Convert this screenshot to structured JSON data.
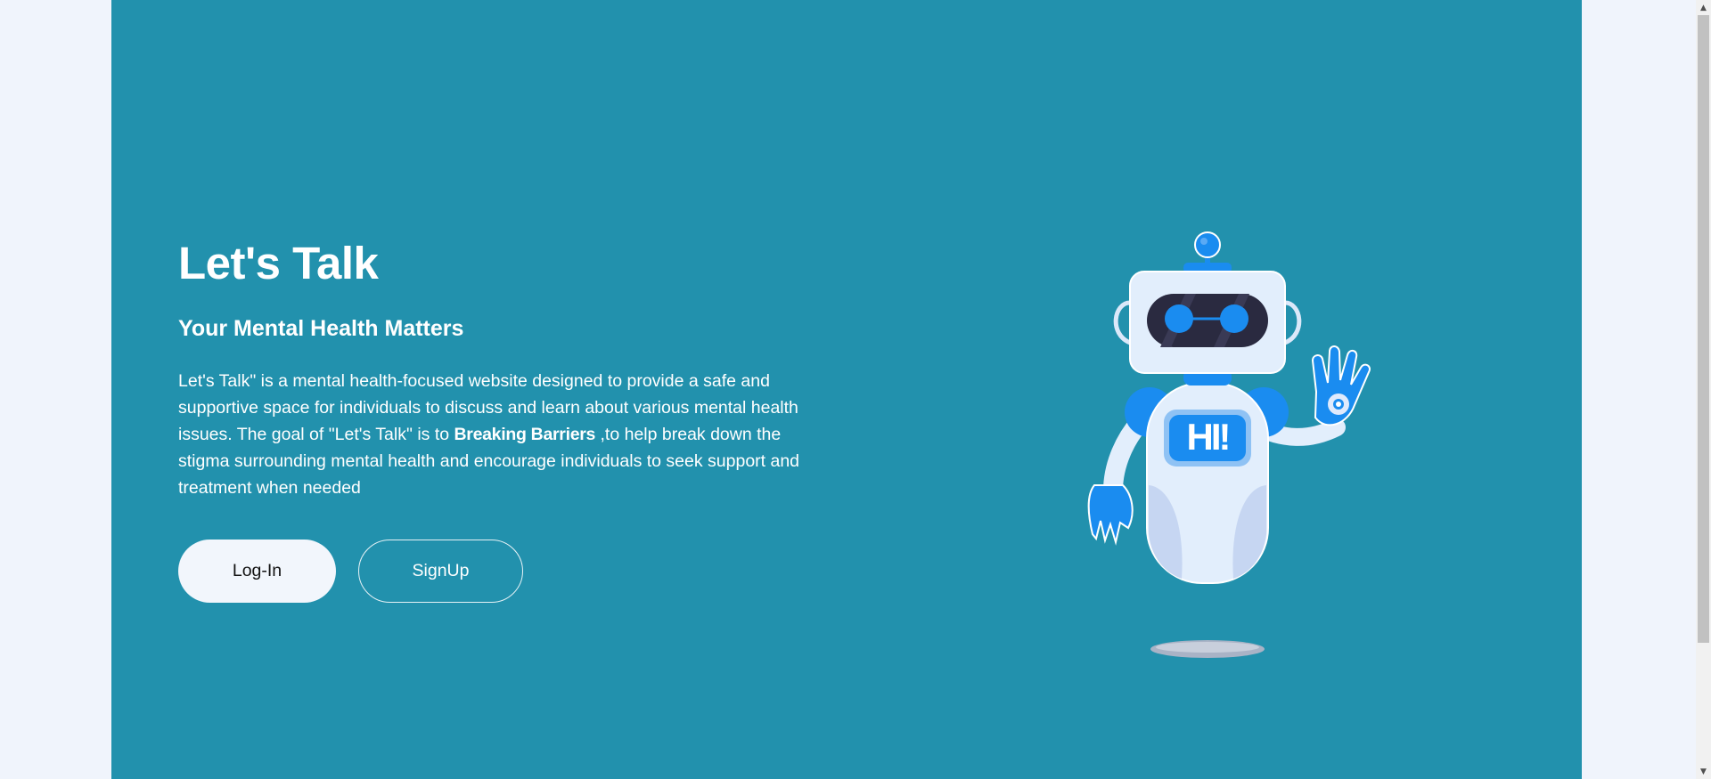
{
  "hero": {
    "title": "Let's Talk",
    "subtitle": "Your Mental Health Matters",
    "description_before": "Let's Talk\" is a mental health-focused website designed to provide a safe and supportive space for individuals to discuss and learn about various mental health issues. The goal of \"Let's Talk\" is to ",
    "description_bold": "Breaking Barriers",
    "description_after": " ,to help break down the stigma surrounding mental health and encourage individuals to seek support and treatment when needed"
  },
  "buttons": {
    "login_label": "Log-In",
    "signup_label": "SignUp"
  },
  "illustration": {
    "badge_text": "HI!"
  },
  "colors": {
    "hero_background": "#2291ad",
    "page_background": "#f0f4fc",
    "robot_accent": "#1a8cf0",
    "robot_body": "#e2eefc"
  },
  "icons": {
    "scroll_up": "scroll-up-arrow-icon",
    "scroll_down": "scroll-down-arrow-icon"
  }
}
